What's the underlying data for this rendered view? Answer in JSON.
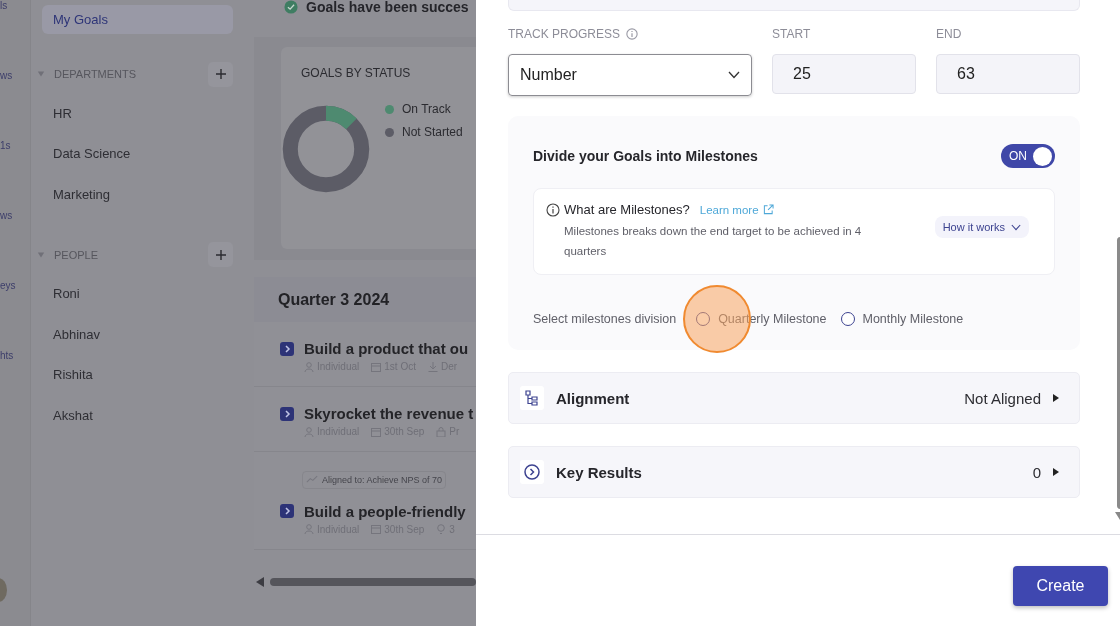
{
  "rail": {
    "labels": [
      "ls",
      "ws",
      "1s",
      "ws",
      "eys",
      "hts"
    ]
  },
  "sidebar": {
    "items": [
      {
        "label": "My Goals",
        "selected": true
      }
    ],
    "sections": [
      {
        "title": "DEPARTMENTS",
        "expanded": true,
        "items": [
          "HR",
          "Data Science",
          "Marketing"
        ]
      },
      {
        "title": "PEOPLE",
        "expanded": true,
        "items": [
          "Roni",
          "Abhinav",
          "Rishita",
          "Akshat"
        ]
      }
    ]
  },
  "banner": {
    "text": "Goals have been succes"
  },
  "status_chart": {
    "title": "GOALS BY STATUS",
    "legend": [
      {
        "label": "On Track",
        "color": "#4e8a70"
      },
      {
        "label": "Not Started",
        "color": "#5c5c66"
      }
    ]
  },
  "goals": {
    "group": "Quarter 3 2024",
    "items": [
      {
        "title": "Build a product that ou",
        "meta": [
          {
            "kind": "owner",
            "text": "Individual"
          },
          {
            "kind": "date",
            "text": "1st Oct"
          },
          {
            "kind": "download",
            "text": "Der"
          }
        ]
      },
      {
        "title": "Skyrocket the revenue t",
        "meta": [
          {
            "kind": "owner",
            "text": "Individual"
          },
          {
            "kind": "date",
            "text": "30th Sep"
          },
          {
            "kind": "lock",
            "text": "Pr"
          }
        ]
      },
      {
        "aligned_to": "Aligned to: Achieve NPS of 70",
        "title": "Build a people-friendly",
        "meta": [
          {
            "kind": "owner",
            "text": "Individual"
          },
          {
            "kind": "date",
            "text": "30th Sep"
          },
          {
            "kind": "bulb",
            "text": "3"
          }
        ]
      }
    ]
  },
  "form": {
    "track_progress": {
      "label": "TRACK PROGRESS",
      "value": "Number"
    },
    "start": {
      "label": "START",
      "value": "25"
    },
    "end": {
      "label": "END",
      "value": "63"
    },
    "milestones": {
      "title": "Divide your Goals into Milestones",
      "toggle": {
        "on": true,
        "label": "ON"
      },
      "info": {
        "title": "What are Milestones?",
        "link": "Learn more",
        "text": "Milestones breaks down the end target to be achieved in 4 quarters",
        "button": "How it works"
      },
      "division": {
        "label": "Select milestones division",
        "options": [
          {
            "label": "Quarterly Milestone",
            "selected": false
          },
          {
            "label": "Monthly Milestone",
            "selected": false
          }
        ]
      }
    },
    "sections": [
      {
        "kind": "alignment",
        "title": "Alignment",
        "value": "Not Aligned"
      },
      {
        "kind": "key_results",
        "title": "Key Results",
        "value": "0"
      }
    ]
  },
  "create_button": "Create"
}
